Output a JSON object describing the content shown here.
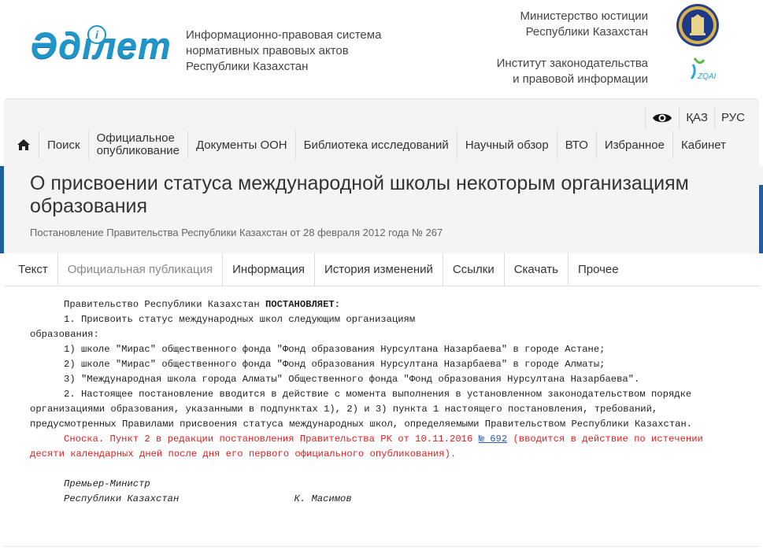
{
  "header": {
    "logo_text": "Әділет",
    "logo_i": "i",
    "site_description_lines": [
      "Информационно-правовая система",
      "нормативных правовых актов",
      "Республики Казахстан"
    ],
    "ministry_lines": [
      "Министерство юстиции",
      "Республики Казахстан"
    ],
    "institute_lines": [
      "Институт законодательства",
      "и правовой информации"
    ],
    "zqai_label": "ZQAI"
  },
  "lang_bar": {
    "kaz": "ҚАЗ",
    "rus": "РУС"
  },
  "nav": {
    "items": [
      "Поиск",
      "Документы ООН",
      "Библиотека исследований",
      "Научный обзор",
      "ВТО",
      "Избранное",
      "Кабинет"
    ],
    "official_lines": [
      "Официальное",
      "опубликование"
    ]
  },
  "document": {
    "title": "О присвоении статуса международной школы некоторым организациям образования",
    "subtitle": "Постановление Правительства Республики Казахстан от 28 февраля 2012 года № 267"
  },
  "tabs": [
    "Текст",
    "Официальная публикация",
    "Информация",
    "История изменений",
    "Ссылки",
    "Скачать",
    "Прочее"
  ],
  "content": {
    "l1_pre": "Правительство Республики Казахстан ",
    "l1_bold": "ПОСТАНОВЛЯЕТ:",
    "l2": "1. Присвоить статус международных школ следующим организациям",
    "l3": "образования:",
    "l4": "1) школе \"Мирас\" общественного фонда \"Фонд образования Нурсултана Назарбаева\" в городе Астане;",
    "l5": "2) школе \"Мирас\" общественного фонда \"Фонд образования Нурсултана Назарбаева\" в городе Алматы;",
    "l6": "3) \"Международная школа города Алматы\" Общественного фонда \"Фонд образования Нурсултана Назарбаева\".",
    "l7": "2. Настоящее постановление вводится в действие с момента выполнения в установленном законодательством порядке",
    "l8": "организациями образования, указанными в подпунктах 1), 2) и 3) пункта 1 настоящего постановления, требований,",
    "l9": "предусмотренных Правилами присвоения статуса международных школ, определяемыми Правительством Республики Казахстан.",
    "note_pre": "Сноска. Пункт 2 в редакции постановления Правительства РК от 10.11.2016 ",
    "note_link": "№ 692",
    "note_post": " (вводится в действие по истечении",
    "note2": "десяти календарных дней после дня его первого официального опубликования).",
    "sig1": "Премьер-Министр",
    "sig2": "Республики Казахстан                    К. Масимов"
  },
  "colors": {
    "brand_blue": "#1f95c9",
    "side_bar": "#1e5e99",
    "note_red": "#e02020"
  }
}
